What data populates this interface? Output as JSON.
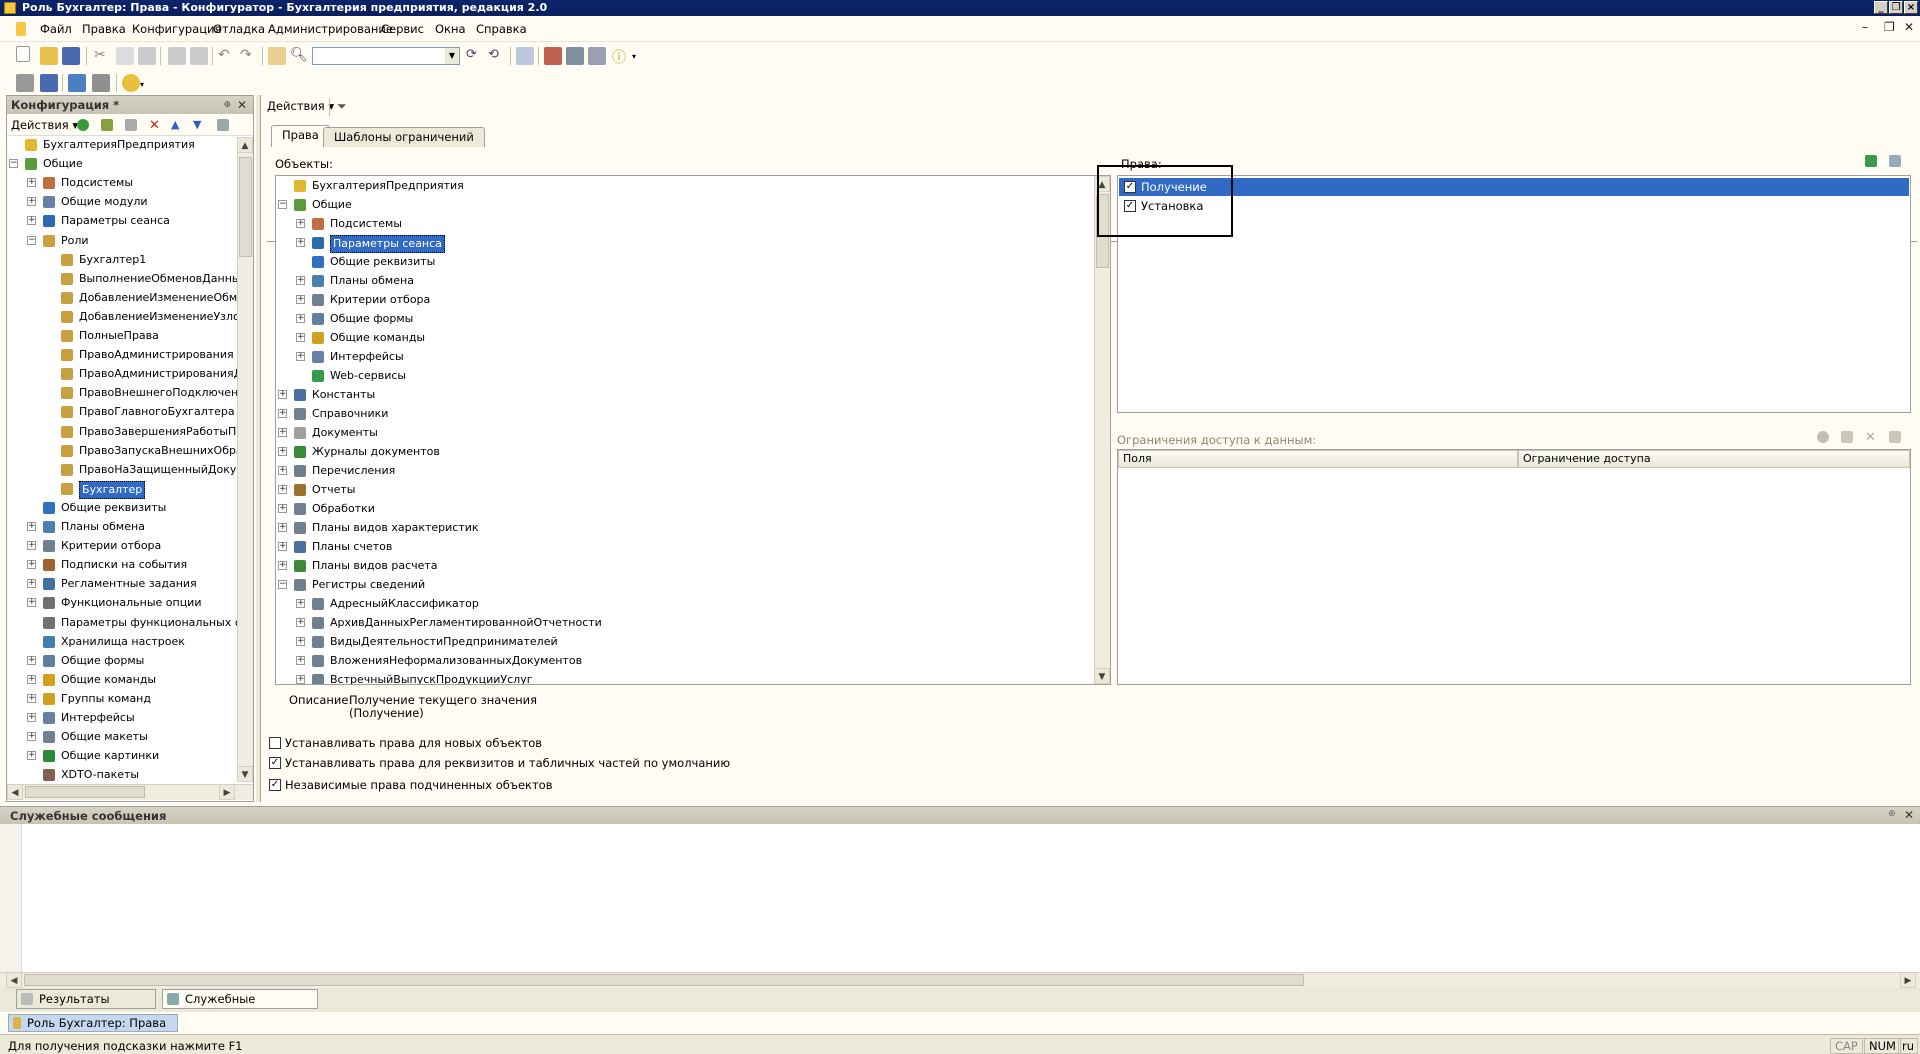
{
  "window": {
    "title": "Роль Бухгалтер: Права - Конфигуратор - Бухгалтерия предприятия, редакция 2.0"
  },
  "menu": [
    "Файл",
    "Правка",
    "Конфигурация",
    "Отладка",
    "Администрирование",
    "Сервис",
    "Окна",
    "Справка"
  ],
  "config_panel": {
    "title": "Конфигурация *",
    "actions": "Действия",
    "tree": [
      {
        "label": "БухгалтерияПредприятия",
        "level": 0,
        "icon": "config-icon",
        "color": "#e0b830"
      },
      {
        "label": "Общие",
        "level": 0,
        "icon": "common-icon",
        "color": "#5a9b3a",
        "expander": "−"
      },
      {
        "label": "Подсистемы",
        "level": 1,
        "icon": "subsystems-icon",
        "color": "#c07040",
        "expander": "+"
      },
      {
        "label": "Общие модули",
        "level": 1,
        "icon": "module-icon",
        "color": "#6a7fa8",
        "expander": "+"
      },
      {
        "label": "Параметры сеанса",
        "level": 1,
        "icon": "session-params-icon",
        "color": "#2a6ab0",
        "expander": "+"
      },
      {
        "label": "Роли",
        "level": 1,
        "icon": "roles-icon",
        "color": "#c8a040",
        "expander": "−"
      },
      {
        "label": "Бухгалтер1",
        "level": 2,
        "icon": "role-icon",
        "color": "#c8a040"
      },
      {
        "label": "ВыполнениеОбменовДанными",
        "level": 2,
        "icon": "role-icon",
        "color": "#c8a040"
      },
      {
        "label": "ДобавлениеИзменениеОбменов",
        "level": 2,
        "icon": "role-icon",
        "color": "#c8a040"
      },
      {
        "label": "ДобавлениеИзменениеУзлов",
        "level": 2,
        "icon": "role-icon",
        "color": "#c8a040"
      },
      {
        "label": "ПолныеПрава",
        "level": 2,
        "icon": "role-icon",
        "color": "#c8a040"
      },
      {
        "label": "ПравоАдминистрирования",
        "level": 2,
        "icon": "role-icon",
        "color": "#c8a040"
      },
      {
        "label": "ПравоАдминистрированияДо",
        "level": 2,
        "icon": "role-icon",
        "color": "#c8a040"
      },
      {
        "label": "ПравоВнешнегоПодключения",
        "level": 2,
        "icon": "role-icon",
        "color": "#c8a040"
      },
      {
        "label": "ПравоГлавногоБухгалтера",
        "level": 2,
        "icon": "role-icon",
        "color": "#c8a040"
      },
      {
        "label": "ПравоЗавершенияРаботыПол",
        "level": 2,
        "icon": "role-icon",
        "color": "#c8a040"
      },
      {
        "label": "ПравоЗапускаВнешнихОбраб",
        "level": 2,
        "icon": "role-icon",
        "color": "#c8a040"
      },
      {
        "label": "ПравоНаЗащищенныйДокум",
        "level": 2,
        "icon": "role-icon",
        "color": "#c8a040"
      },
      {
        "label": "Бухгалтер",
        "level": 2,
        "icon": "role-icon",
        "color": "#c8a040",
        "selected": true
      },
      {
        "label": "Общие реквизиты",
        "level": 1,
        "icon": "attributes-icon",
        "color": "#3070c0"
      },
      {
        "label": "Планы обмена",
        "level": 1,
        "icon": "exchange-plans-icon",
        "color": "#4a80b0",
        "expander": "+"
      },
      {
        "label": "Критерии отбора",
        "level": 1,
        "icon": "filter-criteria-icon",
        "color": "#708090",
        "expander": "+"
      },
      {
        "label": "Подписки на события",
        "level": 1,
        "icon": "event-subscriptions-icon",
        "color": "#a06030",
        "expander": "+"
      },
      {
        "label": "Регламентные задания",
        "level": 1,
        "icon": "scheduled-jobs-icon",
        "color": "#4070a0",
        "expander": "+"
      },
      {
        "label": "Функциональные опции",
        "level": 1,
        "icon": "functional-options-icon",
        "color": "#707070",
        "expander": "+"
      },
      {
        "label": "Параметры функциональных опций",
        "level": 1,
        "icon": "fo-params-icon",
        "color": "#707070"
      },
      {
        "label": "Хранилища настроек",
        "level": 1,
        "icon": "settings-storage-icon",
        "color": "#4080b0"
      },
      {
        "label": "Общие формы",
        "level": 1,
        "icon": "forms-icon",
        "color": "#6080a0",
        "expander": "+"
      },
      {
        "label": "Общие команды",
        "level": 1,
        "icon": "commands-icon",
        "color": "#d0a020",
        "expander": "+"
      },
      {
        "label": "Группы команд",
        "level": 1,
        "icon": "command-groups-icon",
        "color": "#d0a020",
        "expander": "+"
      },
      {
        "label": "Интерфейсы",
        "level": 1,
        "icon": "interfaces-icon",
        "color": "#6a7fa8",
        "expander": "+"
      },
      {
        "label": "Общие макеты",
        "level": 1,
        "icon": "templates-icon",
        "color": "#708090",
        "expander": "+"
      },
      {
        "label": "Общие картинки",
        "level": 1,
        "icon": "pictures-icon",
        "color": "#2a8a3a",
        "expander": "+"
      },
      {
        "label": "XDTO-пакеты",
        "level": 1,
        "icon": "xdto-icon",
        "color": "#806050"
      }
    ]
  },
  "actions_label": "Действия",
  "tabs": [
    {
      "label": "Права",
      "active": true
    },
    {
      "label": "Шаблоны ограничений",
      "active": false
    }
  ],
  "objects_label": "Объекты:",
  "objects_tree": [
    {
      "label": "БухгалтерияПредприятия",
      "level": 0,
      "icon": "config-icon",
      "color": "#e0b830"
    },
    {
      "label": "Общие",
      "level": 0,
      "icon": "common-icon",
      "color": "#5a9b3a",
      "expander": "−"
    },
    {
      "label": "Подсистемы",
      "level": 1,
      "icon": "subsystems-icon",
      "color": "#c07040",
      "expander": "+"
    },
    {
      "label": "Параметры сеанса",
      "level": 1,
      "icon": "session-params-icon",
      "color": "#2a6ab0",
      "expander": "+",
      "selected": true
    },
    {
      "label": "Общие реквизиты",
      "level": 1,
      "icon": "attributes-icon",
      "color": "#3070c0"
    },
    {
      "label": "Планы обмена",
      "level": 1,
      "icon": "exchange-plans-icon",
      "color": "#4a80b0",
      "expander": "+"
    },
    {
      "label": "Критерии отбора",
      "level": 1,
      "icon": "filter-criteria-icon",
      "color": "#708090",
      "expander": "+"
    },
    {
      "label": "Общие формы",
      "level": 1,
      "icon": "forms-icon",
      "color": "#6080a0",
      "expander": "+"
    },
    {
      "label": "Общие команды",
      "level": 1,
      "icon": "commands-icon",
      "color": "#d0a020",
      "expander": "+"
    },
    {
      "label": "Интерфейсы",
      "level": 1,
      "icon": "interfaces-icon",
      "color": "#6a7fa8",
      "expander": "+"
    },
    {
      "label": "Web-сервисы",
      "level": 1,
      "icon": "web-services-icon",
      "color": "#3a9a4a"
    },
    {
      "label": "Константы",
      "level": 0,
      "icon": "constants-icon",
      "color": "#4a70a0",
      "expander": "+"
    },
    {
      "label": "Справочники",
      "level": 0,
      "icon": "catalogs-icon",
      "color": "#708090",
      "expander": "+"
    },
    {
      "label": "Документы",
      "level": 0,
      "icon": "documents-icon",
      "color": "#a0a0a0",
      "expander": "+"
    },
    {
      "label": "Журналы документов",
      "level": 0,
      "icon": "journals-icon",
      "color": "#3a8a3a",
      "expander": "+"
    },
    {
      "label": "Перечисления",
      "level": 0,
      "icon": "enums-icon",
      "color": "#708090",
      "expander": "+"
    },
    {
      "label": "Отчеты",
      "level": 0,
      "icon": "reports-icon",
      "color": "#a07030",
      "expander": "+"
    },
    {
      "label": "Обработки",
      "level": 0,
      "icon": "dataprocessors-icon",
      "color": "#708090",
      "expander": "+"
    },
    {
      "label": "Планы видов характеристик",
      "level": 0,
      "icon": "chart-of-characteristics-icon",
      "color": "#708090",
      "expander": "+"
    },
    {
      "label": "Планы счетов",
      "level": 0,
      "icon": "chart-of-accounts-icon",
      "color": "#4a70a0",
      "expander": "+"
    },
    {
      "label": "Планы видов расчета",
      "level": 0,
      "icon": "chart-of-calc-icon",
      "color": "#3a8a3a",
      "expander": "+"
    },
    {
      "label": "Регистры сведений",
      "level": 0,
      "icon": "info-registers-icon",
      "color": "#708090",
      "expander": "−"
    },
    {
      "label": "АдресныйКлассификатор",
      "level": 1,
      "icon": "register-icon",
      "color": "#708090",
      "expander": "+"
    },
    {
      "label": "АрхивДанныхРегламентированнойОтчетности",
      "level": 1,
      "icon": "register-icon",
      "color": "#708090",
      "expander": "+"
    },
    {
      "label": "ВидыДеятельностиПредпринимателей",
      "level": 1,
      "icon": "register-icon",
      "color": "#708090",
      "expander": "+"
    },
    {
      "label": "ВложенияНеформализованныхДокументов",
      "level": 1,
      "icon": "register-icon",
      "color": "#708090",
      "expander": "+"
    },
    {
      "label": "ВстречныйВыпускПродукцииУслуг",
      "level": 1,
      "icon": "register-icon",
      "color": "#708090",
      "expander": "+"
    }
  ],
  "description": {
    "label": "Описание:",
    "line1": "Получение текущего значения",
    "line2": "(Получение)"
  },
  "rights_label": "Права:",
  "rights": [
    {
      "label": "Получение",
      "checked": true,
      "selected": true
    },
    {
      "label": "Установка",
      "checked": true,
      "selected": false
    }
  ],
  "restrictions_label": "Ограничения доступа к данным:",
  "restrictions_columns": [
    "Поля",
    "Ограничение доступа"
  ],
  "options": [
    {
      "label": "Устанавливать права для новых объектов",
      "checked": false
    },
    {
      "label": "Устанавливать права для реквизитов и табличных частей по умолчанию",
      "checked": true
    },
    {
      "label": "Независимые права подчиненных объектов",
      "checked": true
    }
  ],
  "messages_panel": {
    "title": "Служебные сообщения"
  },
  "bottom_tabs": [
    "Результаты поиска",
    "Служебные сообщения"
  ],
  "window_tab": "Роль Бухгалтер: Права",
  "status": {
    "hint": "Для получения подсказки нажмите F1",
    "cap": "CAP",
    "num": "NUM",
    "lang": "ru"
  }
}
